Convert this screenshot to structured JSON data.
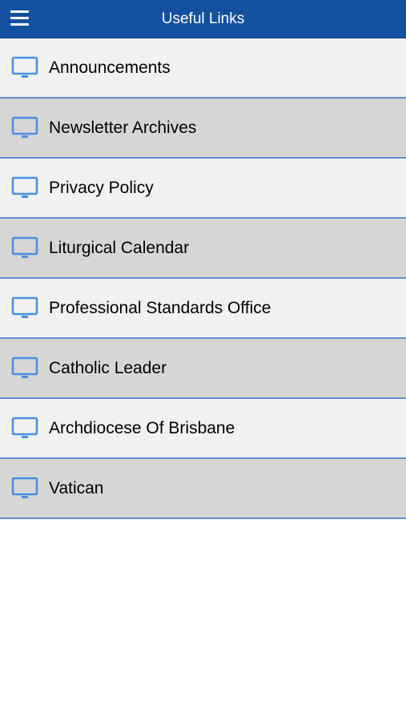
{
  "header": {
    "title": "Useful Links",
    "menu_icon": "hamburger-menu-icon",
    "background": "#1450a0"
  },
  "links": {
    "icon": "monitor-icon",
    "icon_color": "#4a8fe0",
    "divider_color": "#5b8fd4",
    "items": [
      {
        "label": "Announcements"
      },
      {
        "label": "Newsletter Archives"
      },
      {
        "label": "Privacy Policy"
      },
      {
        "label": "Liturgical Calendar"
      },
      {
        "label": "Professional Standards Office"
      },
      {
        "label": "Catholic Leader"
      },
      {
        "label": "Archdiocese Of Brisbane"
      },
      {
        "label": "Vatican"
      }
    ]
  }
}
